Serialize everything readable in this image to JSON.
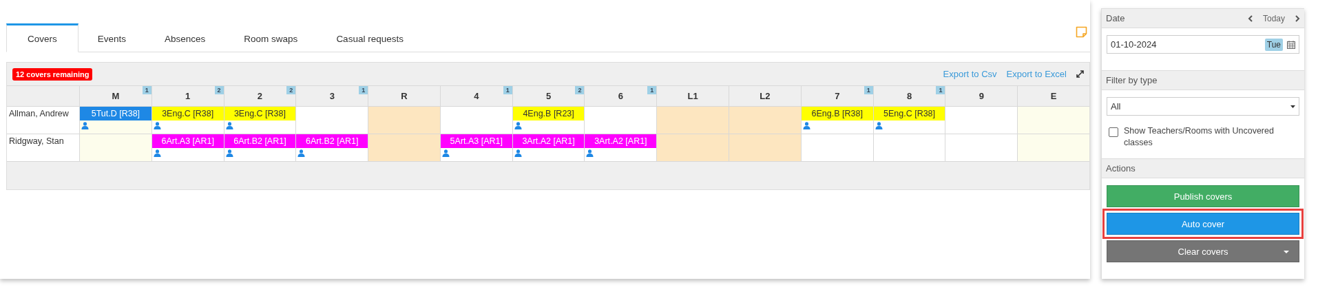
{
  "tabs": [
    {
      "label": "Covers",
      "selected": true
    },
    {
      "label": "Events",
      "selected": false
    },
    {
      "label": "Absences",
      "selected": false
    },
    {
      "label": "Room swaps",
      "selected": false
    },
    {
      "label": "Casual requests",
      "selected": false
    }
  ],
  "table": {
    "remaining_badge": "12 covers remaining",
    "export_links": [
      "Export to Csv",
      "Export to Excel"
    ],
    "columns": [
      {
        "label": "M",
        "count": "1",
        "kind": "edge"
      },
      {
        "label": "1",
        "count": "2",
        "kind": "period"
      },
      {
        "label": "2",
        "count": "2",
        "kind": "period"
      },
      {
        "label": "3",
        "count": "1",
        "kind": "period"
      },
      {
        "label": "R",
        "kind": "break"
      },
      {
        "label": "4",
        "count": "1",
        "kind": "period"
      },
      {
        "label": "5",
        "count": "2",
        "kind": "period"
      },
      {
        "label": "6",
        "count": "1",
        "kind": "period"
      },
      {
        "label": "L1",
        "kind": "break"
      },
      {
        "label": "L2",
        "kind": "break"
      },
      {
        "label": "7",
        "count": "1",
        "kind": "period"
      },
      {
        "label": "8",
        "count": "1",
        "kind": "period"
      },
      {
        "label": "9",
        "kind": "period"
      },
      {
        "label": "E",
        "kind": "edge"
      }
    ],
    "rows": [
      {
        "teacher": "Allman, Andrew",
        "cells": [
          {
            "lesson": "5Tut.D [R38]",
            "color": "#1e88e5"
          },
          {
            "lesson": "3Eng.C [R38]",
            "color": "#ffff00"
          },
          {
            "lesson": "3Eng.C [R38]",
            "color": "#ffff00"
          },
          null,
          null,
          null,
          {
            "lesson": "4Eng.B [R23]",
            "color": "#ffff00"
          },
          null,
          null,
          null,
          {
            "lesson": "6Eng.B [R38]",
            "color": "#ffff00"
          },
          {
            "lesson": "5Eng.C [R38]",
            "color": "#ffff00"
          },
          null,
          null
        ]
      },
      {
        "teacher": "Ridgway, Stan",
        "cells": [
          null,
          {
            "lesson": "6Art.A3 [AR1]",
            "color": "#ff00ff"
          },
          {
            "lesson": "6Art.B2 [AR1]",
            "color": "#ff00ff"
          },
          {
            "lesson": "6Art.B2 [AR1]",
            "color": "#ff00ff"
          },
          null,
          {
            "lesson": "5Art.A3 [AR1]",
            "color": "#ff00ff"
          },
          {
            "lesson": "3Art.A2 [AR1]",
            "color": "#ff00ff"
          },
          {
            "lesson": "3Art.A2 [AR1]",
            "color": "#ff00ff"
          },
          null,
          null,
          null,
          null,
          null,
          null
        ]
      }
    ]
  },
  "sidebar": {
    "date": {
      "title": "Date",
      "today": "Today",
      "value": "01-10-2024",
      "weekday": "Tue"
    },
    "filter": {
      "title": "Filter by type",
      "value": "All",
      "checkbox": {
        "label": "Show Teachers/Rooms with Uncovered classes",
        "checked": false
      }
    },
    "actions": {
      "title": "Actions",
      "buttons": [
        {
          "label": "Publish covers",
          "kind": "success",
          "highlighted": false,
          "dropdown": false
        },
        {
          "label": "Auto cover",
          "kind": "primary",
          "highlighted": true,
          "dropdown": false
        },
        {
          "label": "Clear covers",
          "kind": "secondary",
          "highlighted": false,
          "dropdown": true
        }
      ]
    }
  }
}
